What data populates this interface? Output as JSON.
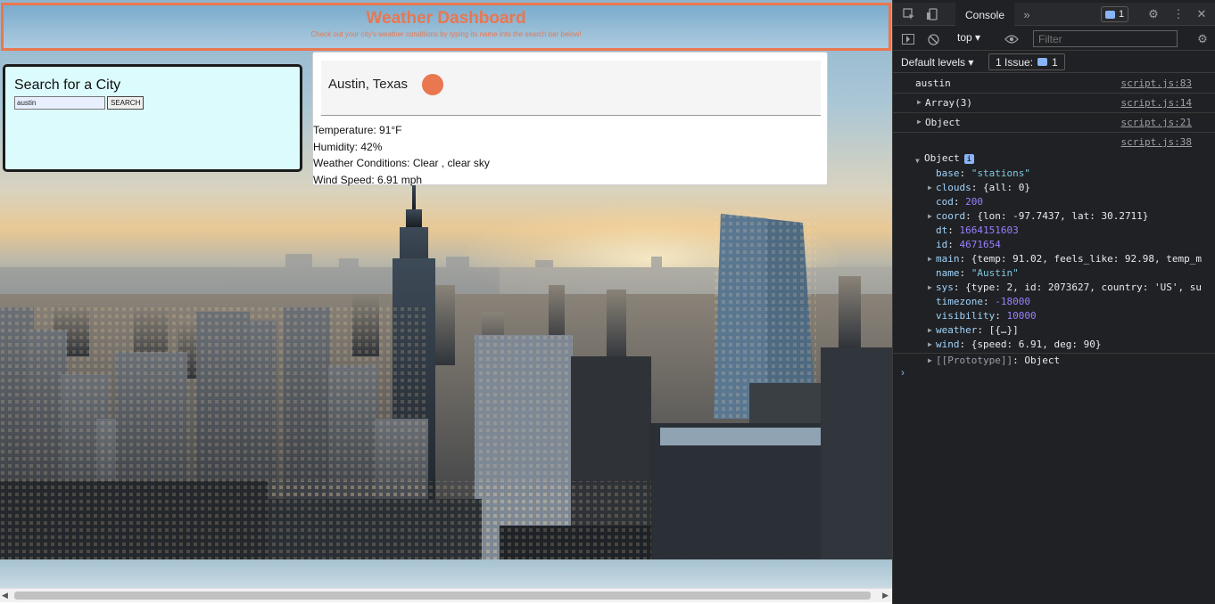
{
  "page": {
    "header": {
      "title": "Weather Dashboard",
      "subtitle": "Check out your city's weather conditions by typing its name into the search bar below!"
    },
    "search": {
      "title": "Search for a City",
      "input_value": "austin",
      "button_label": "SEARCH"
    },
    "result": {
      "city": "Austin, Texas",
      "temperature": "Temperature: 91°F",
      "humidity": "Humidity: 42%",
      "conditions": "Weather Conditions: Clear , clear sky",
      "wind": "Wind Speed: 6.91 mph"
    },
    "colors": {
      "accent": "#e9774f",
      "search_panel_bg": "#dcfbfd"
    }
  },
  "devtools": {
    "tabs": {
      "console": "Console"
    },
    "icons": [
      "inspect-icon",
      "device-toggle-icon",
      "more-tabs-icon",
      "settings-icon",
      "kebab-menu-icon"
    ],
    "issue_badge_count": "1",
    "toolbar": {
      "context": "top",
      "filter_placeholder": "Filter"
    },
    "levels": {
      "label": "Default levels",
      "issues_label": "1 Issue:",
      "issues_count": "1"
    },
    "log": [
      {
        "text": "austin",
        "source": "script.js:83"
      },
      {
        "text": "Array(3)",
        "source": "script.js:14"
      },
      {
        "text": "Object",
        "source": "script.js:21"
      },
      {
        "text": "",
        "source": "script.js:38"
      }
    ],
    "expanded_object": {
      "label": "Object",
      "props": {
        "base_key": "base",
        "base_val": "\"stations\"",
        "clouds_key": "clouds",
        "clouds_val": "{all: 0}",
        "cod_key": "cod",
        "cod_val": "200",
        "coord_key": "coord",
        "coord_val": "{lon: -97.7437, lat: 30.2711}",
        "dt_key": "dt",
        "dt_val": "1664151603",
        "id_key": "id",
        "id_val": "4671654",
        "main_key": "main",
        "main_val": "{temp: 91.02, feels_like: 92.98, temp_m",
        "name_key": "name",
        "name_val": "\"Austin\"",
        "sys_key": "sys",
        "sys_val": "{type: 2, id: 2073627, country: 'US', su",
        "timezone_key": "timezone",
        "timezone_val": "-18000",
        "visibility_key": "visibility",
        "visibility_val": "10000",
        "weather_key": "weather",
        "weather_val": "[{…}]",
        "wind_key": "wind",
        "wind_val": "{speed: 6.91, deg: 90}",
        "proto_key": "[[Prototype]]",
        "proto_val": "Object"
      }
    },
    "prompt": "›"
  }
}
